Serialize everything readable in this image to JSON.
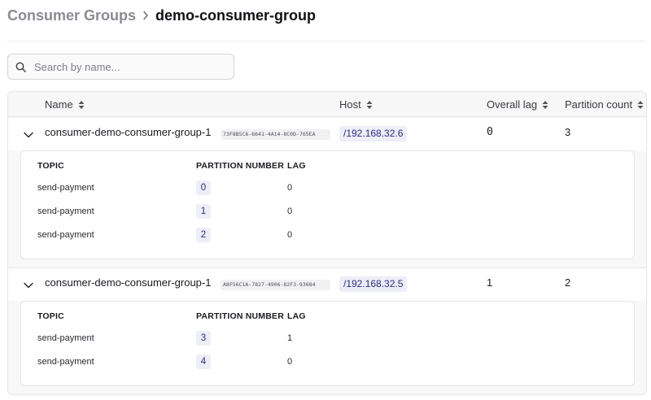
{
  "breadcrumb": {
    "parent": "Consumer Groups",
    "current": "demo-consumer-group"
  },
  "search": {
    "placeholder": "Search by name..."
  },
  "table": {
    "columns": {
      "name": "Name",
      "host": "Host",
      "overall_lag": "Overall lag",
      "partition_count": "Partition count"
    },
    "sub_columns": {
      "topic": "TOPIC",
      "partition_number": "PARTITION NUMBER",
      "lag": "LAG"
    },
    "groups": [
      {
        "name": "consumer-demo-consumer-group-1",
        "id": "73F8B5C6-6641-4A14-8C0D-765EA",
        "host": "/192.168.32.6",
        "overall_lag": "0",
        "partition_count": "3",
        "partitions": [
          {
            "topic": "send-payment",
            "partition": "0",
            "lag": "0"
          },
          {
            "topic": "send-payment",
            "partition": "1",
            "lag": "0"
          },
          {
            "topic": "send-payment",
            "partition": "2",
            "lag": "0"
          }
        ]
      },
      {
        "name": "consumer-demo-consumer-group-1",
        "id": "A8F56C1A-7827-4906-82F3-93684",
        "host": "/192.168.32.5",
        "overall_lag": "1",
        "partition_count": "2",
        "partitions": [
          {
            "topic": "send-payment",
            "partition": "3",
            "lag": "1"
          },
          {
            "topic": "send-payment",
            "partition": "4",
            "lag": "0"
          }
        ]
      }
    ]
  }
}
